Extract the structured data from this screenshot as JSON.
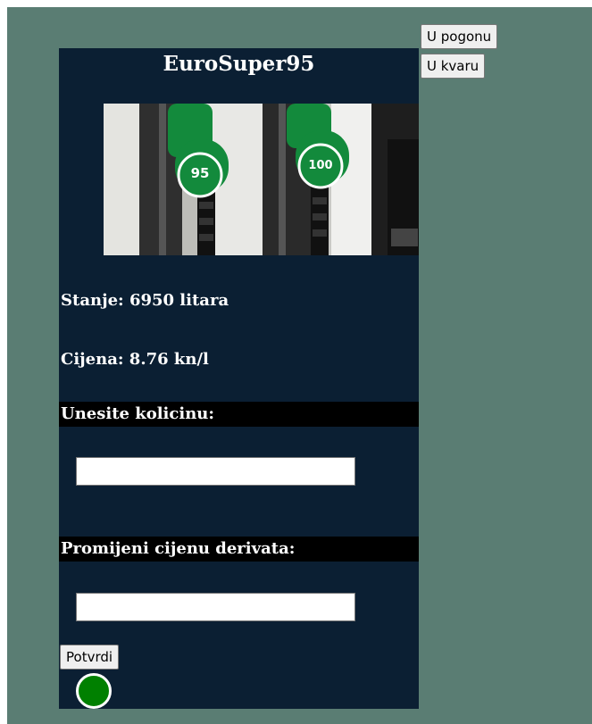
{
  "panel": {
    "title": "EuroSuper95",
    "stanje_text": "Stanje: 6950 litara",
    "cijena_text": "Cijena: 8.76 kn/l",
    "quantity_label": "Unesite kolicinu:",
    "quantity_value": "",
    "price_change_label": "Promijeni cijenu derivata:",
    "price_value": "",
    "confirm_label": "Potvrdi"
  },
  "controls": {
    "in_operation_label": "U pogonu",
    "out_of_order_label": "U kvaru"
  },
  "image": {
    "nozzle_left_text": "95",
    "nozzle_right_text": "100"
  },
  "colors": {
    "page_background": "#5a7d73",
    "panel_background": "#0b1f33",
    "label_bar": "#000000",
    "status_light": "#008000",
    "nozzle_green": "#138a3c"
  },
  "icons": {
    "status_light": "green-status-circle"
  }
}
